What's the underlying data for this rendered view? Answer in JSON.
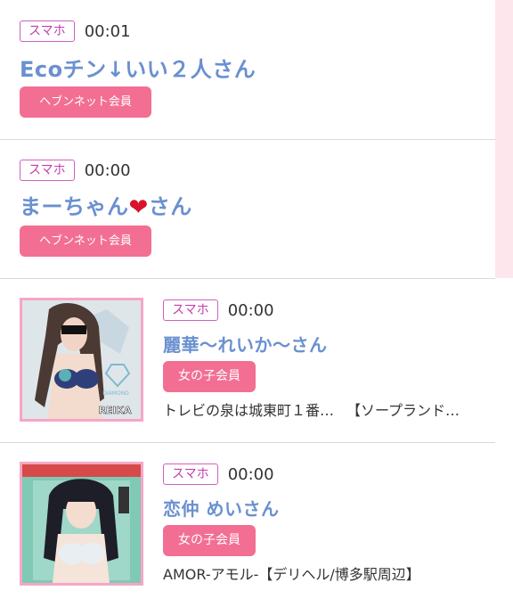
{
  "colors": {
    "device_badge_border": "#d05fbf",
    "name_link": "#6a90d0",
    "member_badge_bg": "#f26f93",
    "side_strip": "#fde7ec",
    "heart": "#d7142a"
  },
  "entries": [
    {
      "device": "スマホ",
      "time": "00:01",
      "name": "Ecoチン↓いい２人さん",
      "member_type": "ヘブンネット会員"
    },
    {
      "device": "スマホ",
      "time": "00:00",
      "name_before_icon": "まーちゃん",
      "name_icon": "heart-icon",
      "name_icon_glyph": "❤",
      "name_after_icon": "さん",
      "member_type": "ヘブンネット会員"
    },
    {
      "device": "スマホ",
      "time": "00:00",
      "name": "麗華〜れいか〜さん",
      "member_type": "女の子会員",
      "shop_location": "トレビの泉は城東町１番…",
      "shop_category": "【ソープランド…",
      "thumb_caption": "REIKA",
      "thumb_subcaption": "DIAMOND"
    },
    {
      "device": "スマホ",
      "time": "00:00",
      "name": "恋仲 めいさん",
      "member_type": "女の子会員",
      "shop_text": "AMOR-アモル-【デリヘル/博多駅周辺】"
    }
  ]
}
